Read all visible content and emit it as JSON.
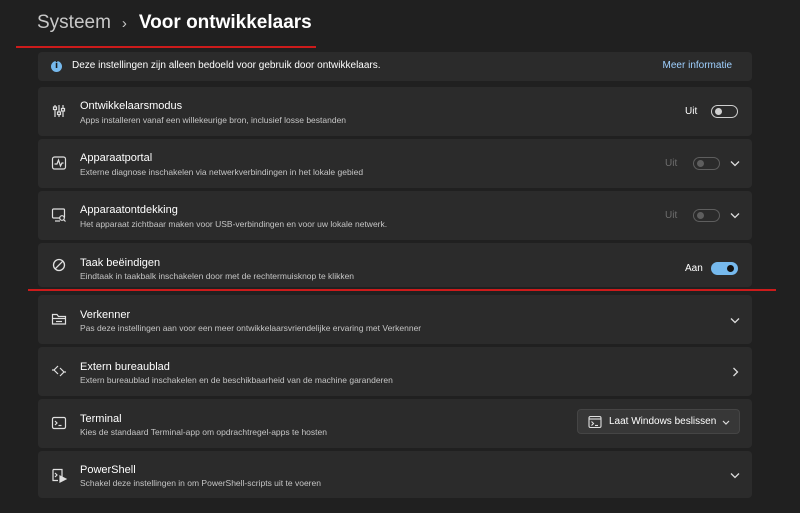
{
  "breadcrumb": {
    "parent": "Systeem",
    "separator": "›",
    "current": "Voor ontwikkelaars"
  },
  "info": {
    "text": "Deze instellingen zijn alleen bedoeld voor gebruik door ontwikkelaars.",
    "link": "Meer informatie"
  },
  "settings": [
    {
      "icon": "developer-mode-icon",
      "title": "Ontwikkelaarsmodus",
      "desc": "Apps installeren vanaf een willekeurige bron, inclusief losse bestanden",
      "state_label": "Uit",
      "on": false,
      "enabled": true
    },
    {
      "icon": "device-portal-icon",
      "title": "Apparaatportal",
      "desc": "Externe diagnose inschakelen via netwerkverbindingen in het lokale gebied",
      "state_label": "Uit",
      "on": false,
      "enabled": false
    },
    {
      "icon": "device-discovery-icon",
      "title": "Apparaatontdekking",
      "desc": "Het apparaat zichtbaar maken voor USB-verbindingen en voor uw lokale netwerk.",
      "state_label": "Uit",
      "on": false,
      "enabled": false
    },
    {
      "icon": "end-task-icon",
      "title": "Taak beëindigen",
      "desc": "Eindtaak in taakbalk inschakelen door met de rechtermuisknop te klikken",
      "state_label": "Aan",
      "on": true,
      "enabled": true
    },
    {
      "icon": "file-explorer-icon",
      "title": "Verkenner",
      "desc": "Pas deze instellingen aan voor een meer ontwikkelaarsvriendelijke ervaring met Verkenner"
    },
    {
      "icon": "remote-desktop-icon",
      "title": "Extern bureaublad",
      "desc": "Extern bureaublad inschakelen en de beschikbaarheid van de machine garanderen"
    },
    {
      "icon": "terminal-icon",
      "title": "Terminal",
      "desc": "Kies de standaard Terminal-app om opdrachtregel-apps te hosten",
      "dropdown": "Laat Windows beslissen"
    },
    {
      "icon": "powershell-icon",
      "title": "PowerShell",
      "desc": "Schakel deze instellingen in om PowerShell-scripts uit te voeren"
    }
  ],
  "colors": {
    "accent": "#76b9ed",
    "annotation": "#cc1b1b",
    "card": "#2b2b2b",
    "background": "#202020"
  }
}
